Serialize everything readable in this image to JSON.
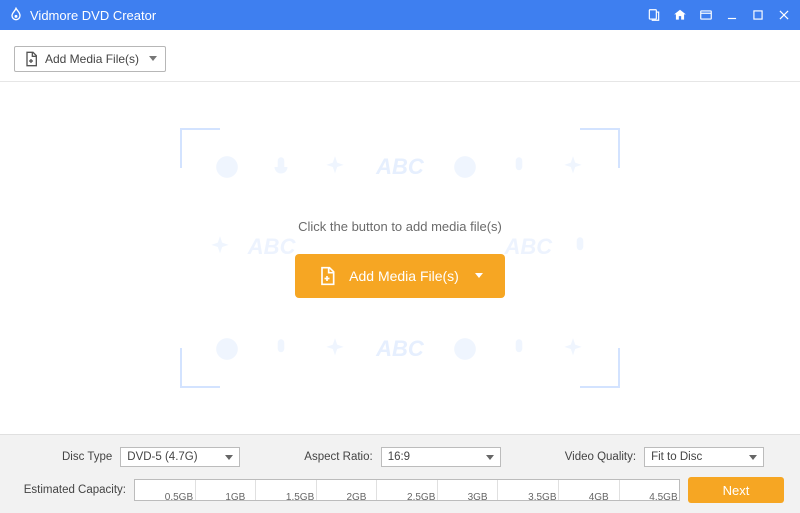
{
  "titlebar": {
    "app_name": "Vidmore DVD Creator"
  },
  "toolbar": {
    "add_media_label": "Add Media File(s)"
  },
  "main": {
    "prompt": "Click the button to add media file(s)",
    "add_media_label": "Add Media File(s)",
    "watermark_text": "ABC"
  },
  "bottom": {
    "disc_type_label": "Disc Type",
    "disc_type_value": "DVD-5 (4.7G)",
    "aspect_ratio_label": "Aspect Ratio:",
    "aspect_ratio_value": "16:9",
    "video_quality_label": "Video Quality:",
    "video_quality_value": "Fit to Disc",
    "estimated_capacity_label": "Estimated Capacity:",
    "capacity_ticks": [
      "0.5GB",
      "1GB",
      "1.5GB",
      "2GB",
      "2.5GB",
      "3GB",
      "3.5GB",
      "4GB",
      "4.5GB"
    ],
    "next_label": "Next"
  }
}
